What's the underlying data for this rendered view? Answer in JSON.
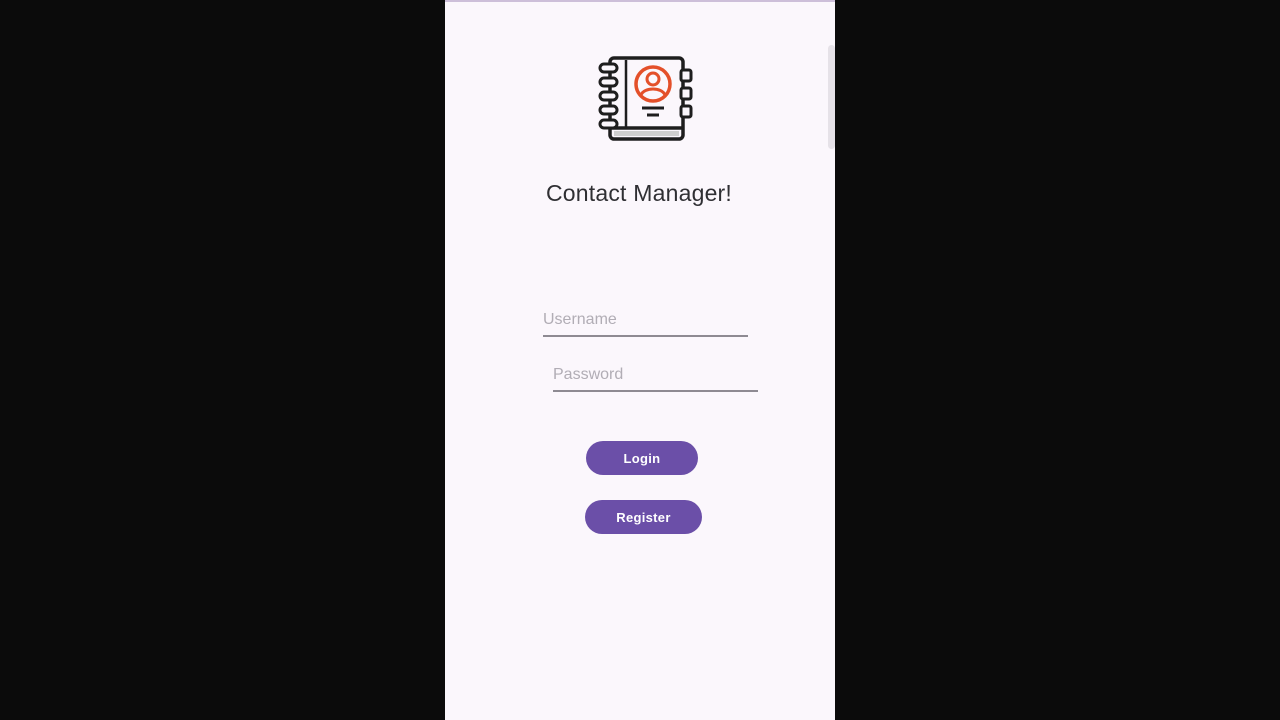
{
  "app": {
    "title": "Contact Manager!",
    "logo_icon": "contact-book-icon"
  },
  "form": {
    "username_placeholder": "Username",
    "password_placeholder": "Password",
    "login_label": "Login",
    "register_label": "Register"
  },
  "colors": {
    "screen_background": "#fbf7fc",
    "outer_background": "#0b0b0b",
    "accent": "#6b4fa8",
    "logo_accent": "#e4502a",
    "title_text": "#2f2f33"
  }
}
